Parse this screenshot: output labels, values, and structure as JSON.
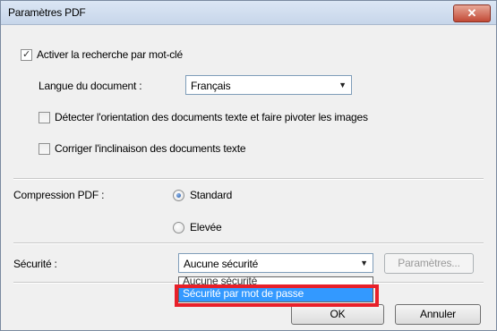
{
  "window": {
    "title": "Paramètres PDF",
    "close_glyph": "✕"
  },
  "keyword_search": {
    "label": "Activer la recherche par mot-clé",
    "checked": true
  },
  "language": {
    "label": "Langue du document :",
    "value": "Français"
  },
  "detect_orientation": {
    "label": "Détecter l'orientation des documents texte et faire pivoter les images",
    "checked": false
  },
  "correct_skew": {
    "label": "Corriger l'inclinaison des documents texte",
    "checked": false
  },
  "compression": {
    "label": "Compression PDF :",
    "options": [
      {
        "label": "Standard",
        "selected": true
      },
      {
        "label": "Elevée",
        "selected": false
      }
    ]
  },
  "security": {
    "label": "Sécurité :",
    "value": "Aucune sécurité",
    "settings_button": "Paramètres...",
    "dropdown_options": [
      "Aucune sécurité",
      "Sécurité par mot de passe"
    ],
    "highlight_color": "#e8202a",
    "selected_option_color": "#3399ff"
  },
  "buttons": {
    "ok": "OK",
    "cancel": "Annuler"
  }
}
